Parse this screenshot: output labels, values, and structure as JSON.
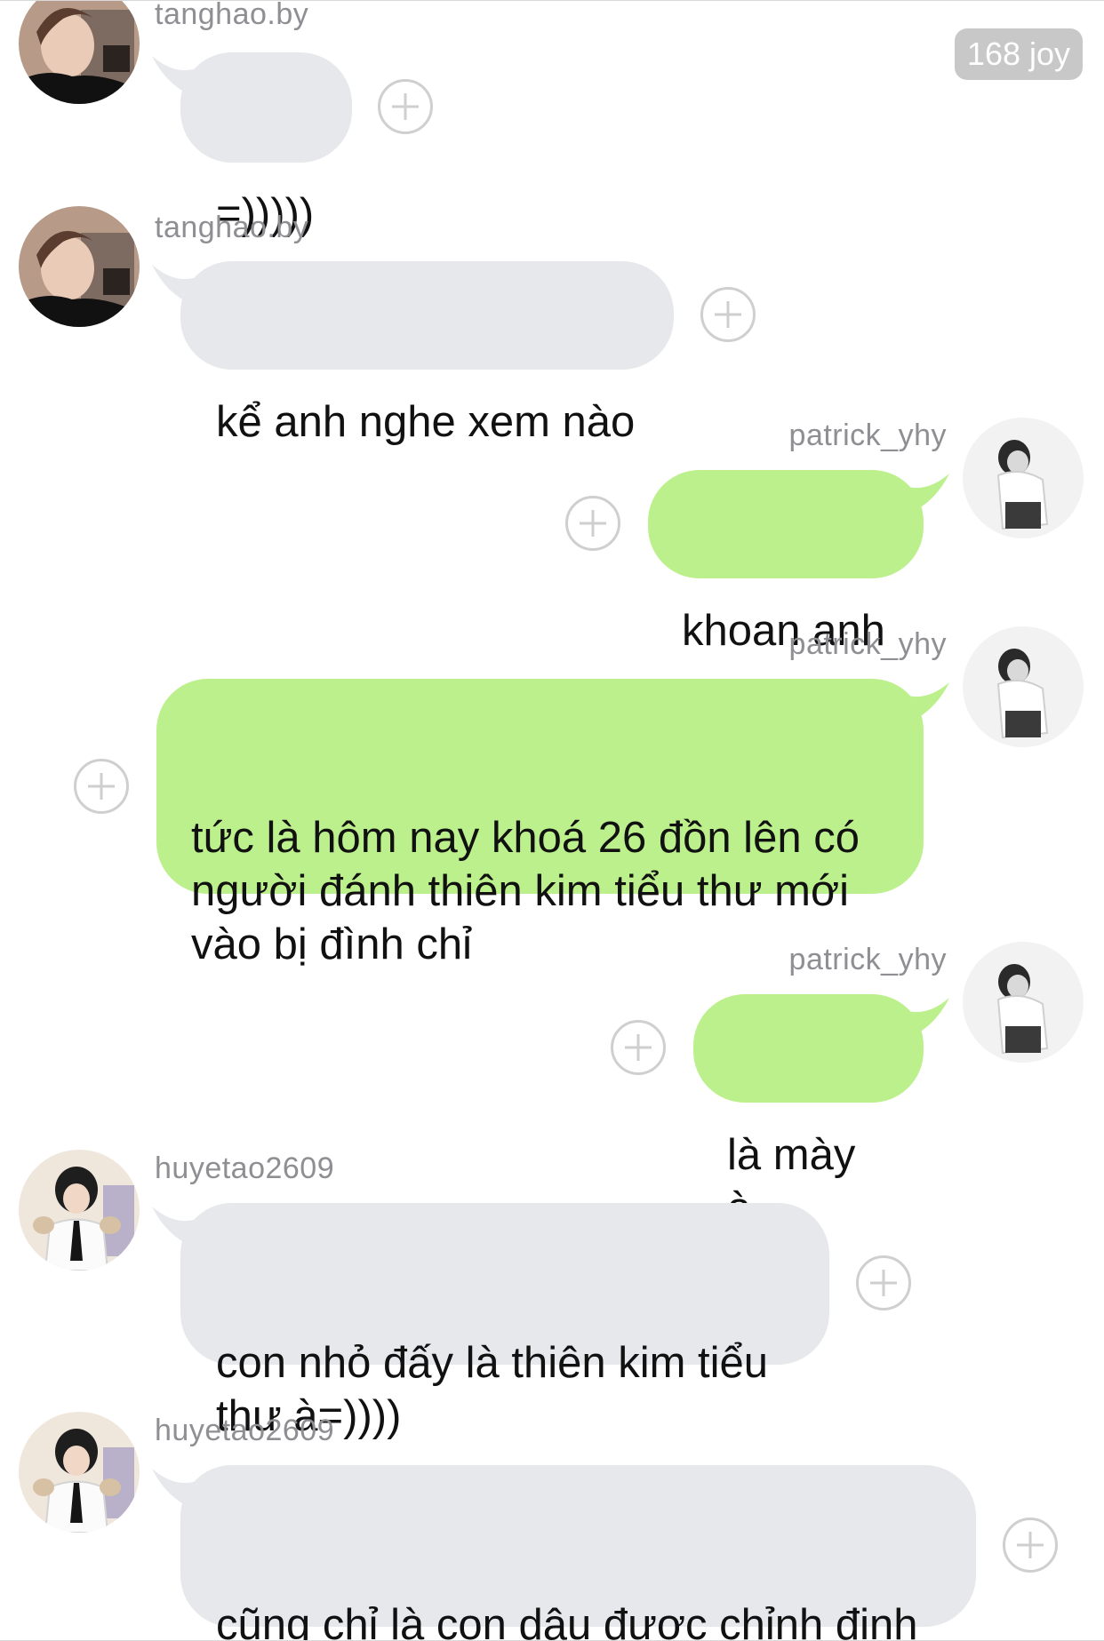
{
  "badge": {
    "text": "168 joy"
  },
  "messages": [
    {
      "user": "tanghao.by",
      "text": "=)))))",
      "side": "left"
    },
    {
      "user": "tanghao.by",
      "text": "kể anh nghe xem nào",
      "side": "left"
    },
    {
      "user": "patrick_yhy",
      "text": "khoan anh",
      "side": "right"
    },
    {
      "user": "patrick_yhy",
      "text": "tức là hôm nay khoá 26 đồn lên có\nngười đánh thiên kim tiểu thư mới\nvào bị đình chỉ",
      "side": "right"
    },
    {
      "user": "patrick_yhy",
      "text": "là mày à",
      "side": "right"
    },
    {
      "user": "huyetao2609",
      "text": "con nhỏ đấy là thiên kim tiểu\nthư à=))))",
      "side": "left"
    },
    {
      "user": "huyetao2609",
      "text": "cũng chỉ là con dâu được chỉnh định\ncủa nhà họ Vương thôi",
      "side": "left"
    }
  ],
  "colors": {
    "incoming_bubble": "#e6e8ec",
    "outgoing_bubble": "#bcf08c",
    "username": "#8e8e93",
    "badge": "#c8c8c8"
  },
  "icons": {
    "add": "plus-circle-icon",
    "avatar": "user-avatar"
  }
}
